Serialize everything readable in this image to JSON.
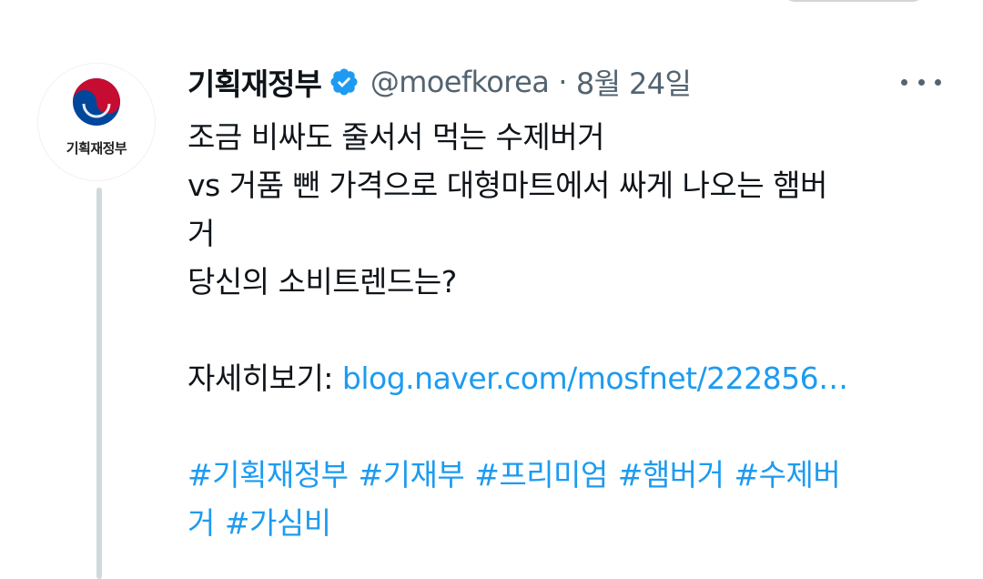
{
  "tweet": {
    "author": {
      "display_name": "기획재정부",
      "handle": "@moefkorea",
      "separator": "·",
      "date": "8월 24일",
      "avatar_text": "기획재정부",
      "verified": true
    },
    "lines": [
      "조금 비싸도 줄서서 먹는 수제버거",
      "vs 거품 뺀 가격으로 대형마트에서 싸게 나오는 햄버",
      "거",
      "당신의 소비트렌드는?"
    ],
    "more_label_prefix": "자세히보기: ",
    "link_text": "blog.naver.com/mosfnet/222856…",
    "hashtags_line1": [
      "#기획재정부",
      "#기재부",
      "#프리미엄",
      "#햄버거",
      "#수제버"
    ],
    "hashtags_line2": [
      "거",
      "#가심비"
    ]
  },
  "colors": {
    "link": "#1d9bf0",
    "text": "#0f1419",
    "secondary": "#536471",
    "thread_line": "#cfd9de"
  },
  "icons": {
    "verified": "verified-badge-icon",
    "more": "more-options-icon",
    "avatar": "government-taegeuk-logo"
  }
}
